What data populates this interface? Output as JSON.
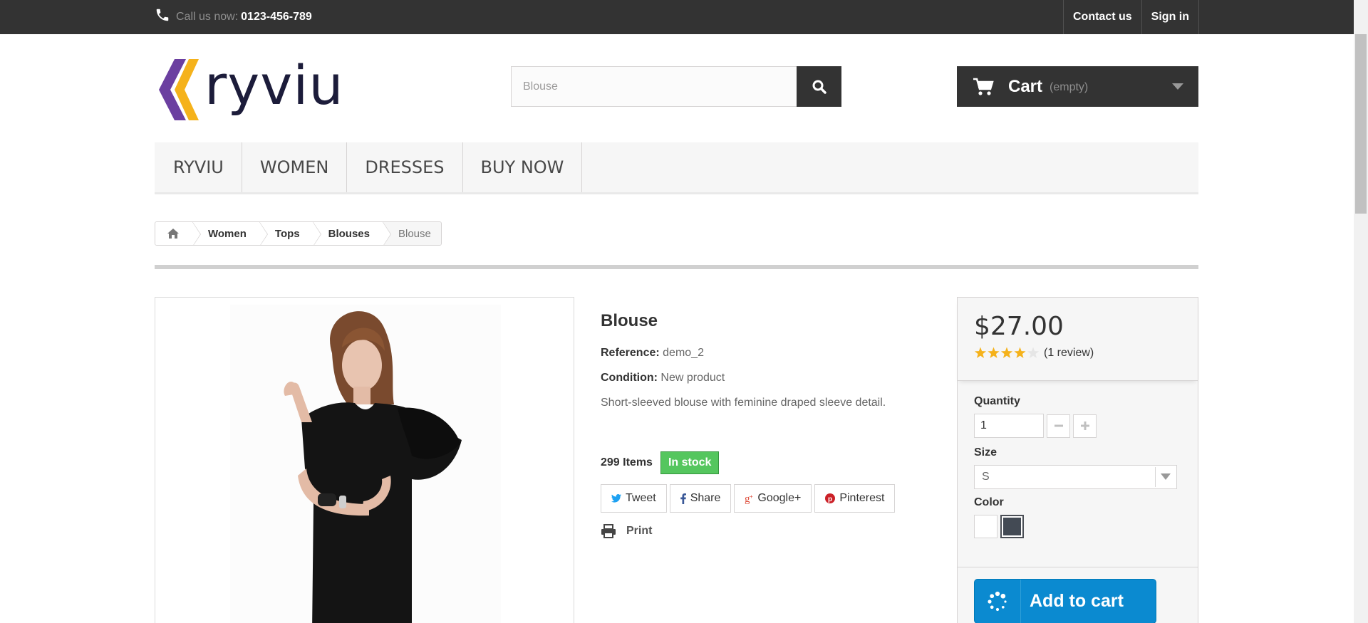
{
  "topbar": {
    "call_label": "Call us now:",
    "phone_number": "0123-456-789",
    "links": [
      "Contact us",
      "Sign in"
    ]
  },
  "logo": {
    "text": "ryviu",
    "colors": {
      "purple": "#6b3fa0",
      "yellow": "#f5b21b",
      "text": "#1c1c3a"
    }
  },
  "search": {
    "placeholder": "Blouse",
    "value": "Blouse",
    "icon": "search-icon"
  },
  "cart": {
    "label": "Cart",
    "status": "(empty)",
    "icon": "cart-icon"
  },
  "menu": {
    "items": [
      "RYVIU",
      "WOMEN",
      "DRESSES",
      "BUY NOW"
    ]
  },
  "breadcrumb": {
    "home_icon": "home-icon",
    "items": [
      "Women",
      "Tops",
      "Blouses"
    ],
    "current": "Blouse"
  },
  "product": {
    "title": "Blouse",
    "reference_label": "Reference:",
    "reference": "demo_2",
    "condition_label": "Condition:",
    "condition": "New product",
    "description": "Short-sleeved blouse with feminine draped sleeve detail.",
    "items_count": "299 Items",
    "stock_status": "In stock",
    "stock_color": "#55c65e",
    "social": [
      "Tweet",
      "Share",
      "Google+",
      "Pinterest"
    ],
    "print_label": "Print"
  },
  "buybox": {
    "price": "$27.00",
    "rating": 4,
    "rating_max": 5,
    "review_count": "(1 review)",
    "quantity_label": "Quantity",
    "quantity": "1",
    "size_label": "Size",
    "size": "S",
    "color_label": "Color",
    "colors": [
      "#ffffff",
      "#434a54"
    ],
    "selected_color_index": 1,
    "add_to_cart": "Add to cart",
    "accent": "#0b8ad0"
  }
}
